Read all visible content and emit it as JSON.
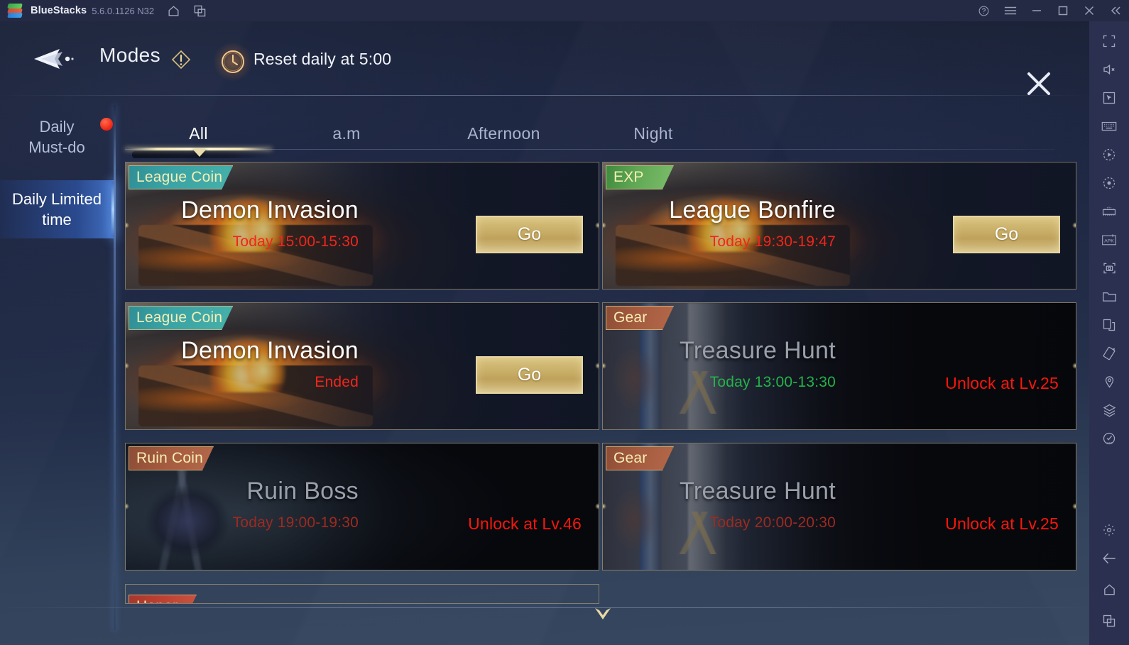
{
  "titlebar": {
    "app_name": "BlueStacks",
    "version": "5.6.0.1126 N32",
    "icons": [
      "home-icon",
      "multi-instance-icon"
    ],
    "controls": [
      "help-icon",
      "menu-icon",
      "minimize-icon",
      "maximize-icon",
      "close-icon",
      "collapse-icon"
    ]
  },
  "header": {
    "title": "Modes",
    "info_icon": "info-diamond-icon",
    "clock_icon": "clock-icon",
    "reset_text": "Reset daily at 5:00",
    "close_label": "close-icon"
  },
  "sidebar": {
    "items": [
      {
        "label_line1": "Daily",
        "label_line2": "Must-do",
        "active": false,
        "has_badge": true
      },
      {
        "label_line1": "Daily Limited",
        "label_line2": "time",
        "active": true,
        "has_badge": false
      }
    ]
  },
  "tabs": [
    {
      "label": "All",
      "active": true
    },
    {
      "label": "a.m",
      "active": false
    },
    {
      "label": "Afternoon",
      "active": false
    },
    {
      "label": "Night",
      "active": false
    }
  ],
  "cards": [
    {
      "badge": "League Coin",
      "badge_color": "teal",
      "title": "Demon Invasion",
      "time": "Today 15:00-15:30",
      "time_state": "red",
      "action": "Go",
      "locked": false,
      "art": "fire"
    },
    {
      "badge": "EXP",
      "badge_color": "green",
      "title": "League Bonfire",
      "time": "Today 19:30-19:47",
      "time_state": "red",
      "action": "Go",
      "locked": false,
      "art": "fire"
    },
    {
      "badge": "League Coin",
      "badge_color": "teal",
      "title": "Demon Invasion",
      "time": "Ended",
      "time_state": "red",
      "action": "Go",
      "locked": false,
      "art": "fire"
    },
    {
      "badge": "Gear",
      "badge_color": "brown",
      "title": "Treasure Hunt",
      "time": "Today 13:00-13:30",
      "time_state": "green",
      "lock_text": "Unlock at Lv.25",
      "locked": true,
      "art": "gear"
    },
    {
      "badge": "Ruin Coin",
      "badge_color": "brown",
      "title": "Ruin Boss",
      "time": "Today 19:00-19:30",
      "time_state": "dimred",
      "lock_text": "Unlock at Lv.46",
      "locked": true,
      "art": "ruin"
    },
    {
      "badge": "Gear",
      "badge_color": "brown",
      "title": "Treasure Hunt",
      "time": "Today 20:00-20:30",
      "time_state": "dimred",
      "lock_text": "Unlock at Lv.25",
      "locked": true,
      "art": "gear"
    },
    {
      "badge": "Honor",
      "badge_color": "red",
      "title": "",
      "time": "",
      "locked": true,
      "art": "honor",
      "partial": true
    }
  ],
  "scroll_hint": "scroll-down-caret-icon",
  "rail": {
    "icons": [
      "fullscreen-icon",
      "mute-icon",
      "cursor-icon",
      "keyboard-icon",
      "macro-record-icon",
      "screen-record-icon",
      "game-controls-icon",
      "install-apk-icon",
      "screenshot-icon",
      "folder-icon",
      "multi-instance-icon",
      "rotate-icon",
      "location-icon",
      "layers-icon",
      "eco-mode-icon",
      "settings-icon",
      "back-icon",
      "home-icon",
      "recents-icon"
    ]
  },
  "colors": {
    "accent_gold": "#d8c27f",
    "alert_red": "#f0261c",
    "ok_green": "#25b24a",
    "badge_teal": "#3aa3a5",
    "badge_green": "#60a855",
    "badge_brown": "#a45b3f",
    "badge_red": "#bd4033",
    "sidebar_active": "#2e56aa",
    "titlebar_bg": "#252a44",
    "rail_bg": "#2b3050"
  }
}
